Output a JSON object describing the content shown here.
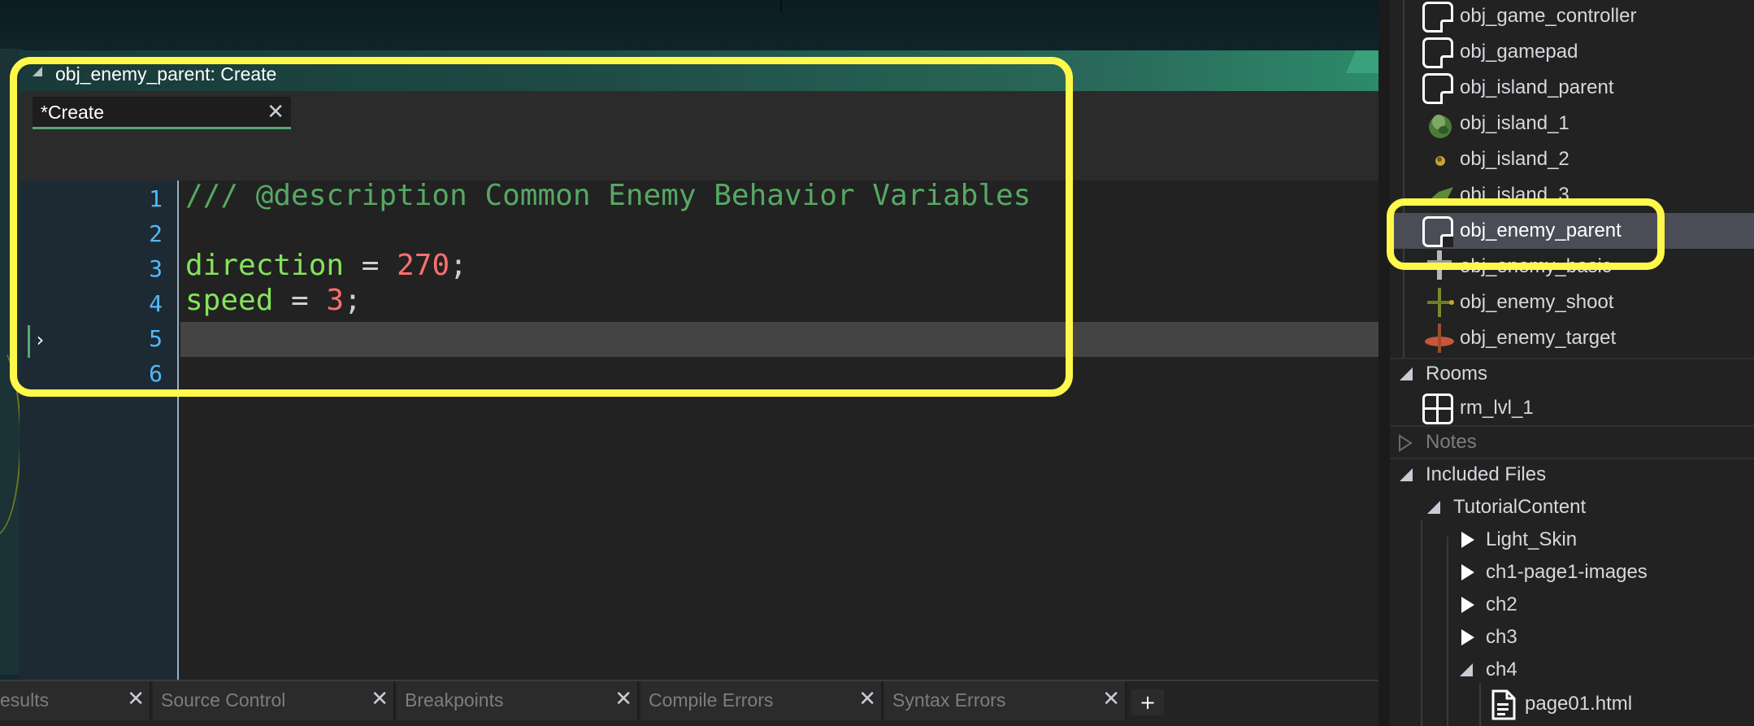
{
  "editor": {
    "title": "obj_enemy_parent: Create",
    "tab_label": "*Create",
    "tab_close": "✕",
    "line_numbers": [
      "1",
      "2",
      "3",
      "4",
      "5",
      "6"
    ],
    "code": {
      "line1_comment": "/// @description Common Enemy Behavior Variables",
      "line3_var": "direction",
      "line3_op": " = ",
      "line3_num": "270",
      "line3_end": ";",
      "line4_var": "speed",
      "line4_op": " = ",
      "line4_num": "3",
      "line4_end": ";"
    },
    "cursor_marker": "›"
  },
  "bottom_tabs": [
    {
      "label": "esults",
      "close": "✕"
    },
    {
      "label": "Source Control",
      "close": "✕"
    },
    {
      "label": "Breakpoints",
      "close": "✕"
    },
    {
      "label": "Compile Errors",
      "close": "✕"
    },
    {
      "label": "Syntax Errors",
      "close": "✕"
    }
  ],
  "bottom_add": "+",
  "resource_tree": {
    "objects": [
      {
        "label": "obj_game_controller",
        "icon": "object-icon"
      },
      {
        "label": "obj_gamepad",
        "icon": "object-icon"
      },
      {
        "label": "obj_island_parent",
        "icon": "object-icon"
      },
      {
        "label": "obj_island_1",
        "icon": "island-sprite-icon"
      },
      {
        "label": "obj_island_2",
        "icon": "island-sprite-icon"
      },
      {
        "label": "obj_island_3",
        "icon": "island-sprite-icon"
      },
      {
        "label": "obj_enemy_parent",
        "icon": "object-icon",
        "selected": true
      },
      {
        "label": "obj_enemy_basic",
        "icon": "enemy-sprite-icon"
      },
      {
        "label": "obj_enemy_shoot",
        "icon": "enemy-sprite-icon"
      },
      {
        "label": "obj_enemy_target",
        "icon": "enemy-sprite-icon"
      }
    ],
    "rooms_header": "Rooms",
    "rooms": [
      {
        "label": "rm_lvl_1",
        "icon": "room-icon"
      }
    ],
    "notes_header": "Notes",
    "included_files_header": "Included Files",
    "tutorial_folder": "TutorialContent",
    "subfolders": [
      "Light_Skin",
      "ch1-page1-images",
      "ch2",
      "ch3",
      "ch4"
    ],
    "file": "page01.html"
  },
  "colors": {
    "highlight": "#fff84a",
    "comment": "#57a864",
    "variable": "#85e35a",
    "number": "#ff6f6f",
    "line_number": "#52b8ff",
    "selected_row": "#4a4d56"
  }
}
